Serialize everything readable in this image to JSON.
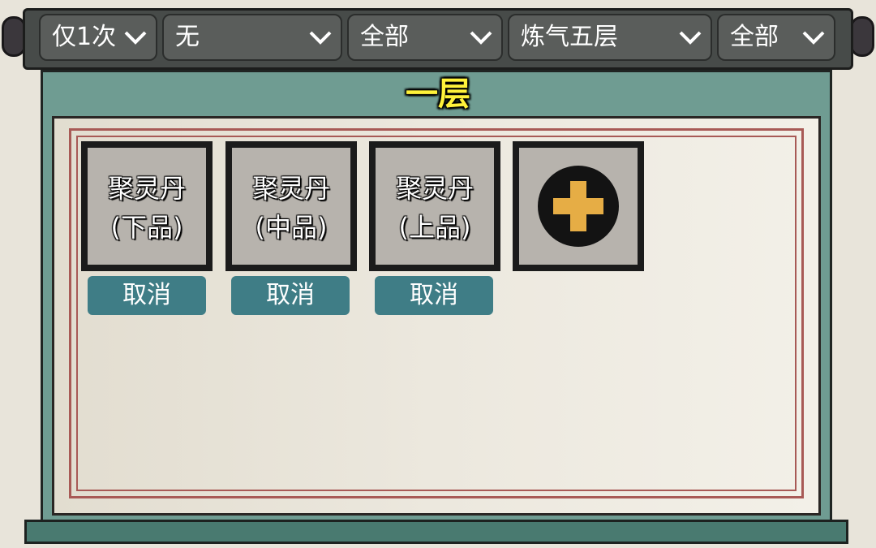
{
  "filters": [
    {
      "label": "仅1次"
    },
    {
      "label": "无"
    },
    {
      "label": "全部"
    },
    {
      "label": "炼气五层"
    },
    {
      "label": "全部"
    }
  ],
  "floor": {
    "title": "一层"
  },
  "items": [
    {
      "name": "聚灵丹",
      "grade": "(下品)",
      "cancel_label": "取消"
    },
    {
      "name": "聚灵丹",
      "grade": "(中品)",
      "cancel_label": "取消"
    },
    {
      "name": "聚灵丹",
      "grade": "(上品)",
      "cancel_label": "取消"
    }
  ],
  "add_slot": {
    "icon": "plus-icon"
  },
  "colors": {
    "title_yellow": "#fff23a",
    "frame_green": "#6f9c92",
    "cancel_button": "#3f7d86",
    "plus_gold": "#e6ad45"
  }
}
